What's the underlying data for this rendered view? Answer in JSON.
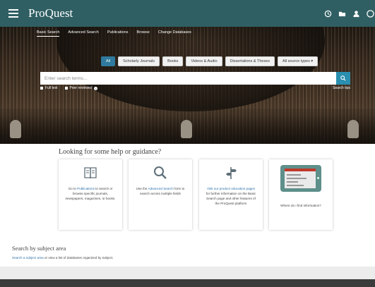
{
  "header": {
    "logo": "ProQuest",
    "icons": [
      "history-icon",
      "folder-icon",
      "user-icon",
      "help-icon"
    ]
  },
  "subnav": {
    "items": [
      "Basic Search",
      "Advanced Search",
      "Publications",
      "Browse",
      "Change Databases"
    ]
  },
  "filters": [
    "All",
    "Scholarly Journals",
    "Books",
    "Videos & Audio",
    "Dissertations & Theses",
    "All source types ▾"
  ],
  "search": {
    "placeholder": "Enter search terms...",
    "full_text": "Full text",
    "peer_reviewed": "Peer reviewed",
    "tips": "Search tips"
  },
  "help": {
    "title": "Looking for some help or guidance?",
    "cards": [
      {
        "pre": "Go to ",
        "link": "Publications",
        "post": " to search or browse specific journals, newspapers, magazines, or books."
      },
      {
        "pre": "Use the ",
        "link": "Advanced Search",
        "post": " form to search across multiple fields"
      },
      {
        "pre": "",
        "link": "Visit our product education pages",
        "post": " for further information on the Basic Search page and other features of the ProQuest platform"
      },
      {
        "pre": "Where do I find information?",
        "link": "",
        "post": ""
      }
    ]
  },
  "subject": {
    "title": "Search by subject area",
    "link": "Search a subject area",
    "post": " or view a list of databases organized by subject."
  },
  "colors": {
    "topbar": "#2f5f63",
    "accent": "#2a8fb0",
    "active_chip": "#2f7a9e"
  }
}
